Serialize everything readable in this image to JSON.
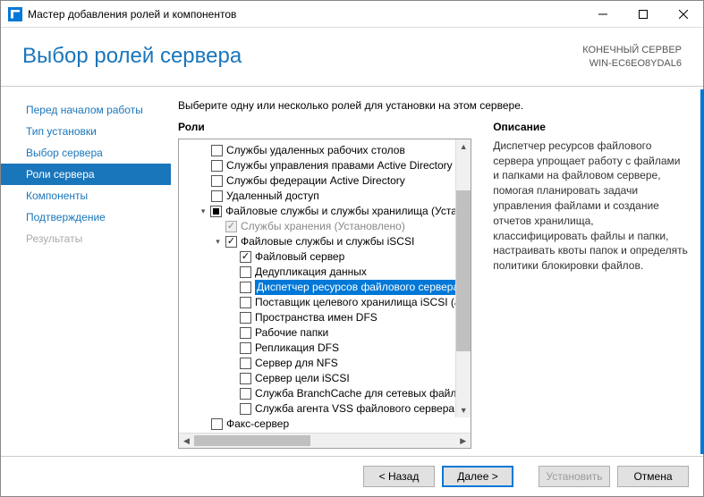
{
  "window": {
    "title": "Мастер добавления ролей и компонентов",
    "header_title": "Выбор ролей сервера",
    "dest_label": "КОНЕЧНЫЙ СЕРВЕР",
    "dest_name": "WIN-EC6EO8YDAL6"
  },
  "sidebar": {
    "items": [
      {
        "label": "Перед началом работы",
        "state": "normal"
      },
      {
        "label": "Тип установки",
        "state": "normal"
      },
      {
        "label": "Выбор сервера",
        "state": "normal"
      },
      {
        "label": "Роли сервера",
        "state": "active"
      },
      {
        "label": "Компоненты",
        "state": "normal"
      },
      {
        "label": "Подтверждение",
        "state": "normal"
      },
      {
        "label": "Результаты",
        "state": "disabled"
      }
    ]
  },
  "content": {
    "instruction": "Выберите одну или несколько ролей для установки на этом сервере.",
    "roles_title": "Роли",
    "desc_title": "Описание",
    "desc_text": "Диспетчер ресурсов файлового сервера упрощает работу с файлами и папками на файловом сервере, помогая планировать задачи управления файлами и создание отчетов хранилища, классифицировать файлы и папки, настраивать квоты папок и определять политики блокировки файлов."
  },
  "tree": [
    {
      "indent": 1,
      "check": "",
      "label": "Службы удаленных рабочих столов"
    },
    {
      "indent": 1,
      "check": "",
      "label": "Службы управления правами Active Directory"
    },
    {
      "indent": 1,
      "check": "",
      "label": "Службы федерации Active Directory"
    },
    {
      "indent": 1,
      "check": "",
      "label": "Удаленный доступ"
    },
    {
      "indent": 1,
      "expand": "▾",
      "check": "indet",
      "label": "Файловые службы и службы хранилища (Устано"
    },
    {
      "indent": 2,
      "check": "checked disabled",
      "labelcls": "disabled",
      "label": "Службы хранения (Установлено)"
    },
    {
      "indent": 2,
      "expand": "▾",
      "check": "checked",
      "label": "Файловые службы и службы iSCSI"
    },
    {
      "indent": 3,
      "check": "checked",
      "label": "Файловый сервер"
    },
    {
      "indent": 3,
      "check": "",
      "label": "Дедупликация данных"
    },
    {
      "indent": 3,
      "check": "",
      "selected": true,
      "label": "Диспетчер ресурсов файлового сервера"
    },
    {
      "indent": 3,
      "check": "",
      "label": "Поставщик целевого хранилища iSCSI (а"
    },
    {
      "indent": 3,
      "check": "",
      "label": "Пространства имен DFS"
    },
    {
      "indent": 3,
      "check": "",
      "label": "Рабочие папки"
    },
    {
      "indent": 3,
      "check": "",
      "label": "Репликация DFS"
    },
    {
      "indent": 3,
      "check": "",
      "label": "Сервер для NFS"
    },
    {
      "indent": 3,
      "check": "",
      "label": "Сервер цели iSCSI"
    },
    {
      "indent": 3,
      "check": "",
      "label": "Служба BranchCache для сетевых файлов"
    },
    {
      "indent": 3,
      "check": "",
      "label": "Служба агента VSS файлового сервера"
    },
    {
      "indent": 1,
      "check": "",
      "label": "Факс-сервер"
    }
  ],
  "footer": {
    "back": "< Назад",
    "next": "Далее >",
    "install": "Установить",
    "cancel": "Отмена"
  }
}
